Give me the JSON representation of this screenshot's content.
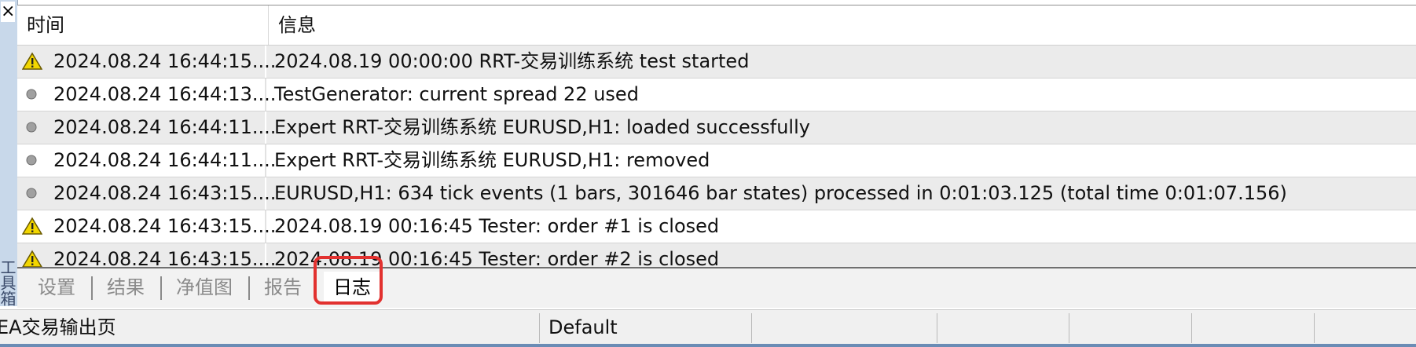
{
  "window": {
    "close_glyph": "×",
    "side_label": "工具箱"
  },
  "table": {
    "columns": {
      "time": "时间",
      "info": "信息"
    },
    "rows": [
      {
        "icon": "warning-icon",
        "time": "2024.08.24 16:44:15....",
        "message": "2024.08.19 00:00:00  RRT-交易训练系统 test started"
      },
      {
        "icon": "info-dot-icon",
        "time": "2024.08.24 16:44:13....",
        "message": "TestGenerator: current spread 22 used"
      },
      {
        "icon": "info-dot-icon",
        "time": "2024.08.24 16:44:11....",
        "message": "Expert RRT-交易训练系统 EURUSD,H1: loaded successfully"
      },
      {
        "icon": "info-dot-icon",
        "time": "2024.08.24 16:44:11....",
        "message": "Expert RRT-交易训练系统 EURUSD,H1: removed"
      },
      {
        "icon": "info-dot-icon",
        "time": "2024.08.24 16:43:15....",
        "message": "EURUSD,H1: 634 tick events (1 bars, 301646 bar states) processed in 0:01:03.125 (total time 0:01:07.156)"
      },
      {
        "icon": "warning-icon",
        "time": "2024.08.24 16:43:15....",
        "message": "2024.08.19 00:16:45  Tester: order #1 is closed"
      },
      {
        "icon": "warning-icon",
        "time": "2024.08.24 16:43:15....",
        "message": "2024.08.19 00:16:45  Tester: order #2 is closed"
      }
    ]
  },
  "tabs": [
    {
      "label": "设置",
      "active": false
    },
    {
      "label": "结果",
      "active": false
    },
    {
      "label": "净值图",
      "active": false
    },
    {
      "label": "报告",
      "active": false
    },
    {
      "label": "日志",
      "active": true
    }
  ],
  "status_bar": {
    "left_text": "EA交易输出页",
    "profile": "Default"
  },
  "colors": {
    "highlight": "#e2312f",
    "warning_fill": "#f2d600",
    "info_dot": "#9a9a9a",
    "row_shade": "#ebebeb"
  }
}
